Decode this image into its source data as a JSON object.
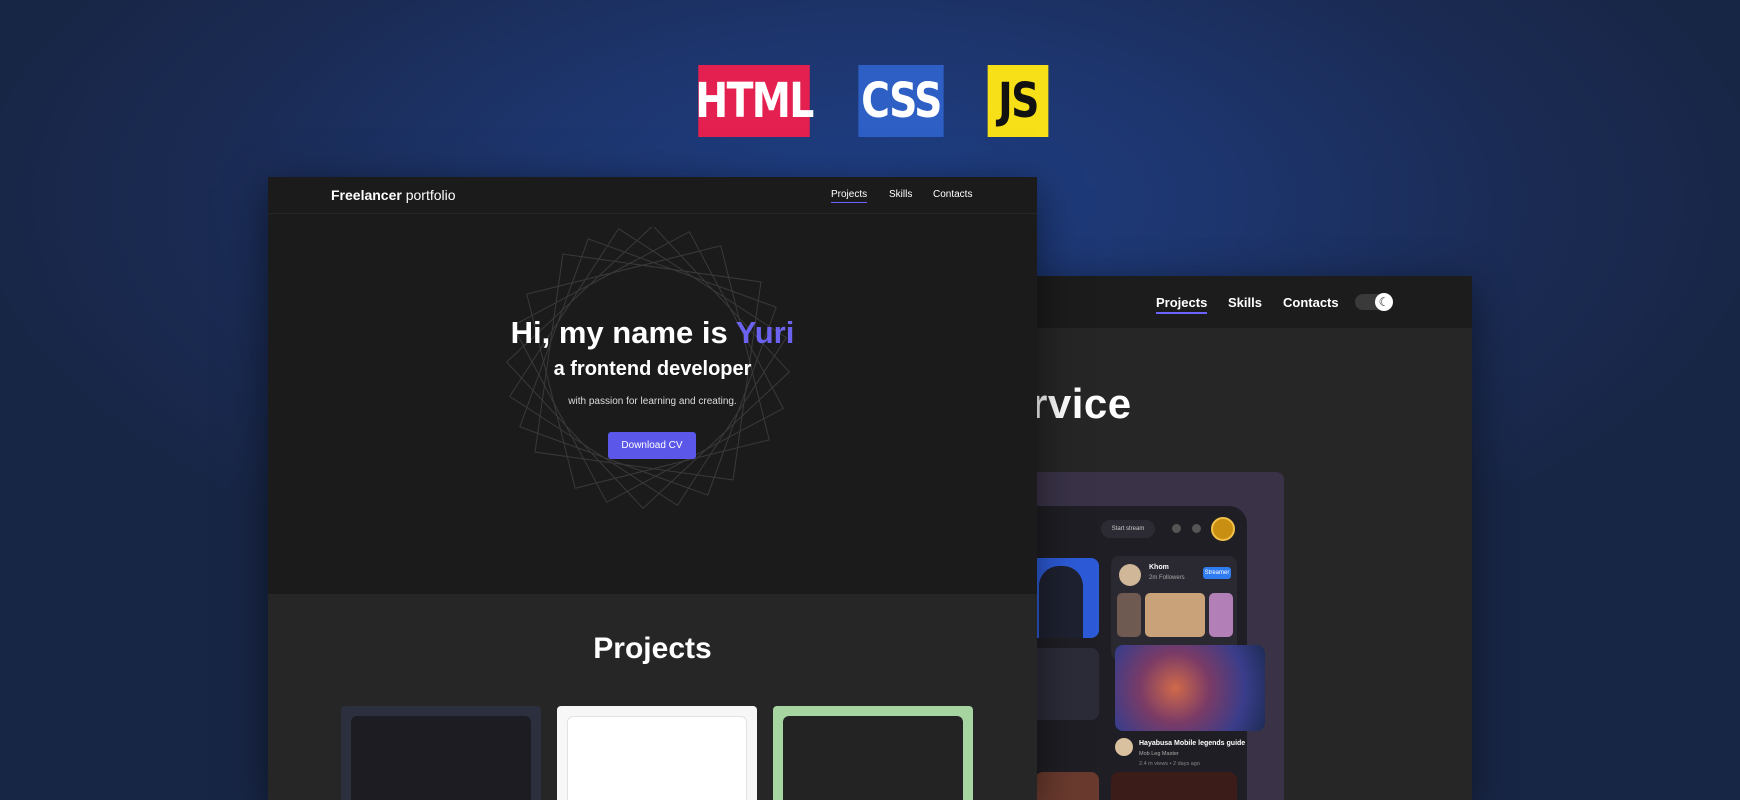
{
  "badges": {
    "html": "HTML",
    "css": "CSS",
    "js": "JS"
  },
  "colors": {
    "accent": "#6b63ef",
    "html_badge": "#e3204f",
    "css_badge": "#2d5fc4",
    "js_badge": "#f7e018",
    "button": "#5b57e8"
  },
  "back_window": {
    "nav": {
      "projects": "Projects",
      "skills": "Skills",
      "contacts": "Contacts",
      "theme_toggle_icon": "moon-icon"
    },
    "title_fragment": "rvice",
    "app": {
      "start_stream": "Start stream",
      "streamer_name": "Khom",
      "streamer_followers": "2m Followers",
      "streamer_badge": "Streamer",
      "guide_title": "Hayabusa Mobile legends guide",
      "guide_subtitle": "Mob Leg Master",
      "guide_meta": "2.4 m views  •  2 days ago"
    }
  },
  "front_window": {
    "logo_bold": "Freelancer",
    "logo_light": " portfolio",
    "nav": {
      "projects": "Projects",
      "skills": "Skills",
      "contacts": "Contacts"
    },
    "hero": {
      "greeting": "Hi, my name is ",
      "name": "Yuri",
      "role": "a frontend developer",
      "tagline": "with passion for learning and creating.",
      "cta": "Download CV"
    },
    "projects_title": "Projects"
  }
}
